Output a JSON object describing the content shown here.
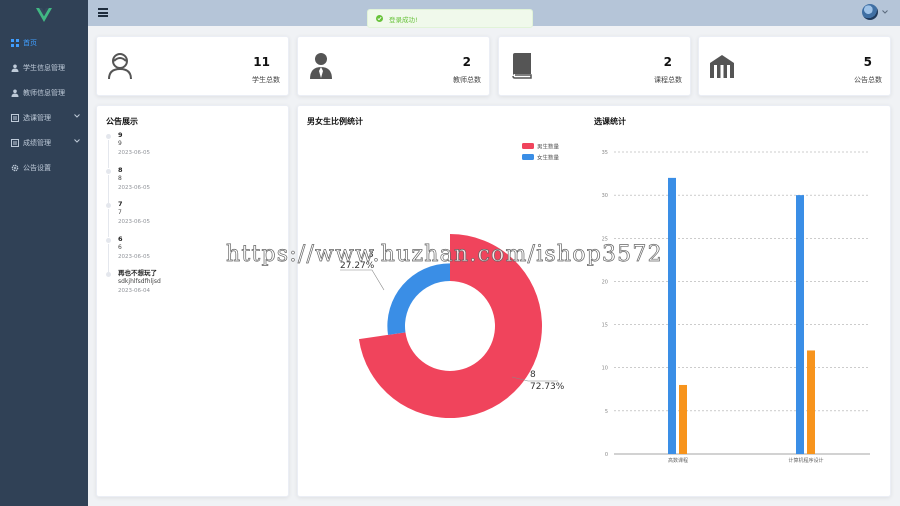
{
  "sidebar": {
    "items": [
      {
        "label": "首页",
        "icon": "grid-icon",
        "active": true
      },
      {
        "label": "学生信息管理",
        "icon": "user-icon"
      },
      {
        "label": "教师信息管理",
        "icon": "user-icon"
      },
      {
        "label": "选课管理",
        "icon": "list-icon",
        "expandable": true
      },
      {
        "label": "成绩管理",
        "icon": "list-icon",
        "expandable": true
      },
      {
        "label": "公告设置",
        "icon": "gear-icon"
      }
    ]
  },
  "toast": {
    "text": "登录成功!"
  },
  "stats": [
    {
      "value": "11",
      "label": "学生总数",
      "icon": "student-icon"
    },
    {
      "value": "2",
      "label": "教师总数",
      "icon": "teacher-icon"
    },
    {
      "value": "2",
      "label": "课程总数",
      "icon": "book-icon"
    },
    {
      "value": "5",
      "label": "公告总数",
      "icon": "building-icon"
    }
  ],
  "notices": {
    "title": "公告展示",
    "items": [
      {
        "title": "9",
        "content": "9",
        "time": "2023-06-05"
      },
      {
        "title": "8",
        "content": "8",
        "time": "2023-06-05"
      },
      {
        "title": "7",
        "content": "7",
        "time": "2023-06-05"
      },
      {
        "title": "6",
        "content": "6",
        "time": "2023-06-05"
      },
      {
        "title": "再也不想玩了",
        "content": "sdkjhlfsdfhljsd",
        "time": "2023-06-04"
      }
    ]
  },
  "watermark": "https://www.huzhan.com/ishop3572",
  "chart_data": [
    {
      "type": "pie",
      "title": "男女生比例统计",
      "legend": [
        "男生数量",
        "女生数量"
      ],
      "slices": [
        {
          "name": "男生数量",
          "value": 8,
          "percent": "72.73%",
          "color": "#f0445c"
        },
        {
          "name": "女生数量",
          "value": 3,
          "percent": "27.27%",
          "color": "#3a8ee6"
        }
      ],
      "labels": [
        {
          "value": "8",
          "percent": "72.73%"
        },
        {
          "value": "3",
          "percent": "27.27%"
        }
      ]
    },
    {
      "type": "bar",
      "title": "选课统计",
      "categories": [
        "高数课程",
        "计算机程序设计"
      ],
      "series": [
        {
          "values": [
            32,
            30
          ],
          "color": "#3a8ee6"
        },
        {
          "values": [
            8,
            12
          ],
          "color": "#f7941d"
        }
      ],
      "ylim": [
        0,
        35
      ],
      "yticks": [
        "0",
        "5",
        "10",
        "15",
        "20",
        "25",
        "30",
        "35"
      ],
      "grid": true
    }
  ]
}
